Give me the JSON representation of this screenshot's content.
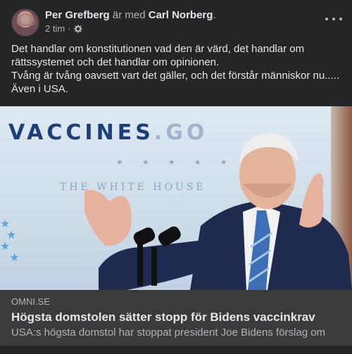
{
  "post": {
    "author": "Per Grefberg",
    "with_text": "är med",
    "tagged": "Carl Norberg",
    "period": ".",
    "time": "2 tim",
    "separator": "·",
    "privacy_icon": "gear-icon",
    "more_icon": "more-options-icon",
    "text_lines": [
      "Det handlar om konstitutionen vad den är värd, det handlar om",
      "rättssystemet och det handlar om opinionen.",
      "Tvång är tvång oavsett vart det gäller, och det förstår människor nu.....",
      "Även i USA."
    ]
  },
  "image": {
    "backdrop_word": "VACCINES",
    "backdrop_suffix": ".GO",
    "backdrop_stars": "★ ★ ★ ★ ★",
    "backdrop_house": "THE WHITE HOUSE"
  },
  "link": {
    "domain": "OMNI.SE",
    "title": "Högsta domstolen sätter stopp för Bidens vaccinkrav",
    "description": "USA:s högsta domstol har stoppat president Joe Bidens förslag om"
  },
  "colors": {
    "card": "#242526",
    "link_bg": "#3a3b3c",
    "primary_text": "#e4e6eb",
    "secondary_text": "#b0b3b8"
  }
}
